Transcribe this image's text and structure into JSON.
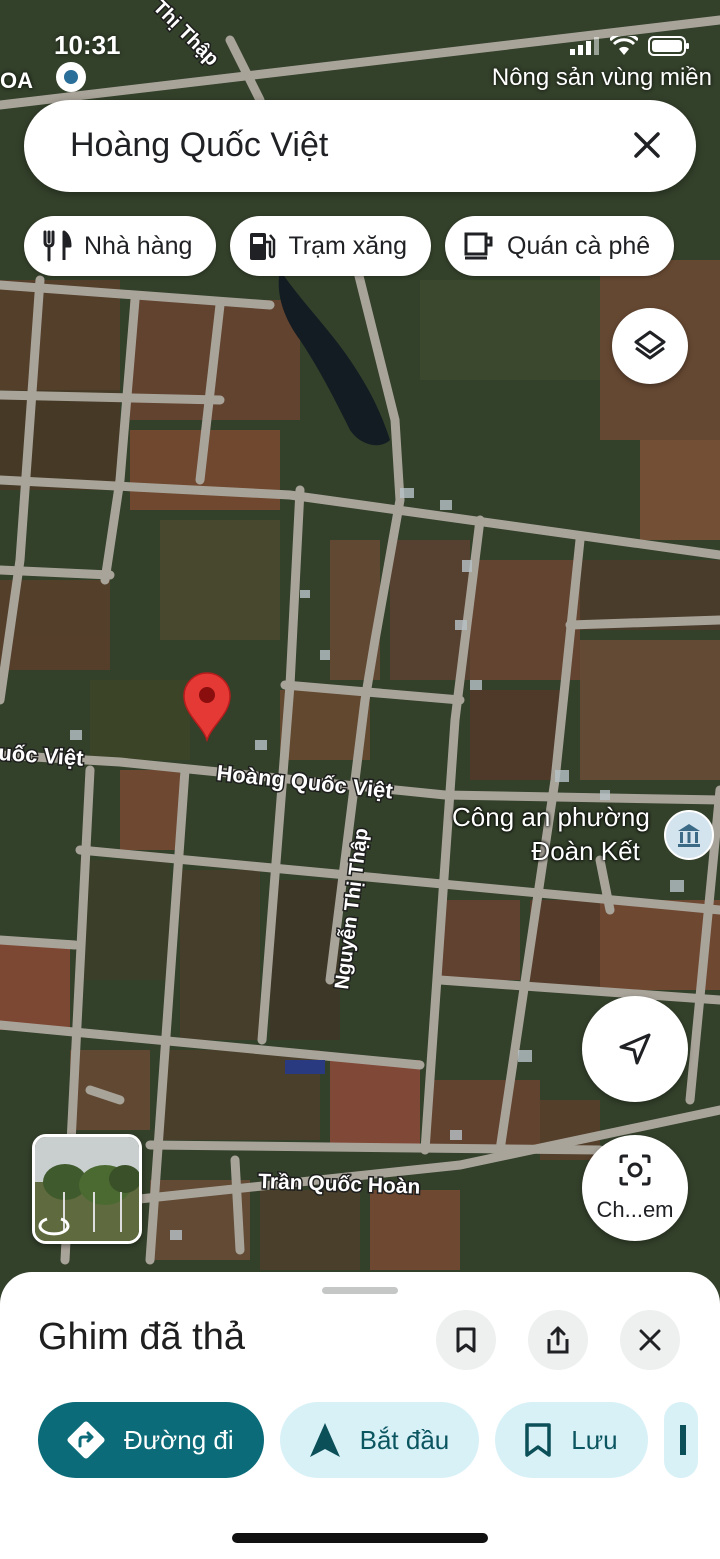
{
  "status_bar": {
    "time": "10:31",
    "carrier_text": "Nông sản vùng miền",
    "left_clip_text": "OA",
    "icons": [
      "signal-icon",
      "wifi-icon",
      "battery-icon"
    ]
  },
  "search": {
    "query": "Hoàng Quốc Việt"
  },
  "chips": [
    {
      "label": "Nhà hàng",
      "icon": "restaurant-icon"
    },
    {
      "label": "Trạm xăng",
      "icon": "gas-station-icon"
    },
    {
      "label": "Quán cà phê",
      "icon": "coffee-icon"
    }
  ],
  "map": {
    "road_labels": {
      "hoang_quoc_viet": "Hoàng Quốc Việt",
      "hoang_quoc_viet_left": "uốc Việt",
      "nguyen_thi_thap": "Nguyễn Thị Thập",
      "nguyen_thi_thap_top": "Thị Thập",
      "tran_quoc_hoan": "Trần Quốc Hoàn"
    },
    "poi": {
      "line1": "Công an phường",
      "line2": "Đoàn Kết",
      "icon": "police-station-icon"
    }
  },
  "lens_button": {
    "label": "Ch...em"
  },
  "sheet": {
    "title": "Ghim đã thả",
    "actions": [
      {
        "label": "Đường đi",
        "icon": "directions-icon"
      },
      {
        "label": "Bắt đầu",
        "icon": "navigation-arrow-icon"
      },
      {
        "label": "Lưu",
        "icon": "bookmark-icon"
      }
    ]
  },
  "colors": {
    "primary_action": "#0b6b78",
    "secondary_action": "#d8f1f7",
    "pin": "#e53935"
  }
}
